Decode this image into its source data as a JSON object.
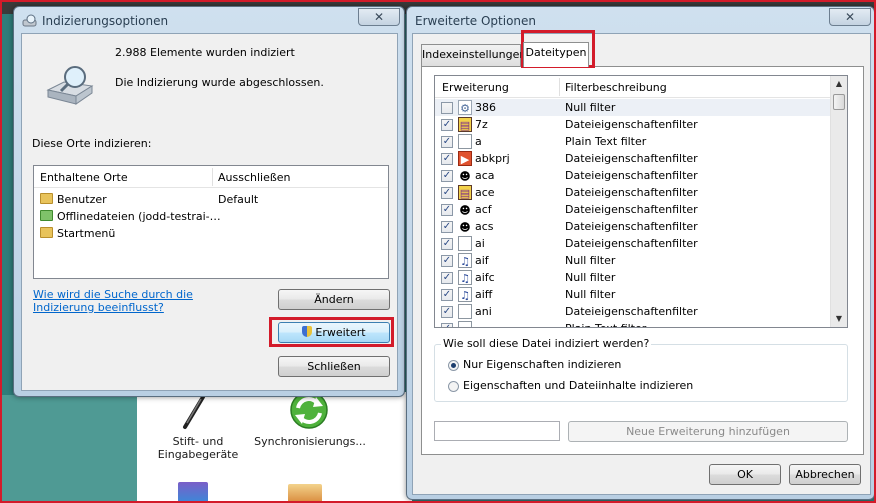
{
  "left_window": {
    "title": "Indizierungsoptionen",
    "close_label": "✕",
    "indexed_count": "2.988 Elemente wurden indiziert",
    "indexing_status": "Die Indizierung wurde abgeschlossen.",
    "locations_label": "Diese Orte indizieren:",
    "columns": {
      "included": "Enthaltene Orte",
      "exclude": "Ausschließen"
    },
    "locations": [
      {
        "name": "Benutzer",
        "exclude": "Default"
      },
      {
        "name": "Offlinedateien (jodd-testrai-…",
        "exclude": ""
      },
      {
        "name": "Startmenü",
        "exclude": ""
      }
    ],
    "help_link": "Wie wird die Suche durch die Indizierung beeinflusst?",
    "buttons": {
      "modify": "Ändern",
      "advanced": "Erweitert",
      "close": "Schließen"
    }
  },
  "right_window": {
    "title": "Erweiterte Optionen",
    "close_label": "✕",
    "tabs": [
      {
        "label": "Indexeinstellungen"
      },
      {
        "label": "Dateitypen"
      }
    ],
    "columns": {
      "extension": "Erweiterung",
      "filter": "Filterbeschreibung"
    },
    "filetypes": [
      {
        "ext": "386",
        "filter": "Null filter",
        "checked": false,
        "icon": "gear-file-icon"
      },
      {
        "ext": "7z",
        "filter": "Dateieigenschaftenfilter",
        "checked": true,
        "icon": "archive-icon"
      },
      {
        "ext": "a",
        "filter": "Plain Text filter",
        "checked": true,
        "icon": "blank-file-icon"
      },
      {
        "ext": "abkprj",
        "filter": "Dateieigenschaftenfilter",
        "checked": true,
        "icon": "project-file-icon"
      },
      {
        "ext": "aca",
        "filter": "Dateieigenschaftenfilter",
        "checked": true,
        "icon": "agent-character-icon"
      },
      {
        "ext": "ace",
        "filter": "Dateieigenschaftenfilter",
        "checked": true,
        "icon": "archive-icon"
      },
      {
        "ext": "acf",
        "filter": "Dateieigenschaftenfilter",
        "checked": true,
        "icon": "agent-character-icon"
      },
      {
        "ext": "acs",
        "filter": "Dateieigenschaftenfilter",
        "checked": true,
        "icon": "agent-character-icon"
      },
      {
        "ext": "ai",
        "filter": "Dateieigenschaftenfilter",
        "checked": true,
        "icon": "blank-file-icon"
      },
      {
        "ext": "aif",
        "filter": "Null filter",
        "checked": true,
        "icon": "audio-file-icon"
      },
      {
        "ext": "aifc",
        "filter": "Null filter",
        "checked": true,
        "icon": "audio-file-icon"
      },
      {
        "ext": "aiff",
        "filter": "Null filter",
        "checked": true,
        "icon": "audio-file-icon"
      },
      {
        "ext": "ani",
        "filter": "Dateieigenschaftenfilter",
        "checked": true,
        "icon": "blank-file-icon"
      },
      {
        "ext": "",
        "filter": "Plain Text filter",
        "checked": true,
        "icon": "blank-file-icon"
      }
    ],
    "index_question": "Wie soll diese Datei indiziert werden?",
    "options": [
      {
        "label": "Nur Eigenschaften indizieren",
        "selected": true
      },
      {
        "label": "Eigenschaften und Dateiinhalte indizieren",
        "selected": false
      }
    ],
    "new_extension_value": "",
    "add_extension_button": "Neue Erweiterung hinzufügen",
    "ok_button": "OK",
    "cancel_button": "Abbrechen"
  },
  "desktop": {
    "items": [
      {
        "label": "Stift- und\nEingabegeräte"
      },
      {
        "label": "Synchronisierungs..."
      }
    ]
  }
}
